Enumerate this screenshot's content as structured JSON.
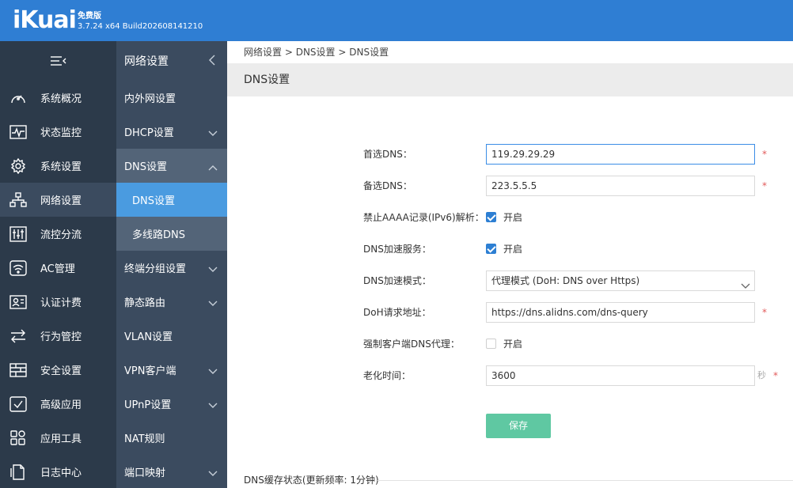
{
  "header": {
    "logo": "iKuai",
    "edition": "免费版",
    "version": "3.7.24 x64 Build202608141210"
  },
  "sidebar": {
    "items": [
      {
        "label": "系统概况",
        "icon": "dashboard-icon"
      },
      {
        "label": "状态监控",
        "icon": "monitor-icon"
      },
      {
        "label": "系统设置",
        "icon": "gear-icon"
      },
      {
        "label": "网络设置",
        "icon": "network-icon"
      },
      {
        "label": "流控分流",
        "icon": "sliders-icon"
      },
      {
        "label": "AC管理",
        "icon": "wifi-icon"
      },
      {
        "label": "认证计费",
        "icon": "id-card-icon"
      },
      {
        "label": "行为管控",
        "icon": "arrows-icon"
      },
      {
        "label": "安全设置",
        "icon": "firewall-icon"
      },
      {
        "label": "高级应用",
        "icon": "checkbox-icon"
      },
      {
        "label": "应用工具",
        "icon": "apps-icon"
      },
      {
        "label": "日志中心",
        "icon": "document-icon"
      }
    ]
  },
  "subnav": {
    "title": "网络设置",
    "items": [
      {
        "label": "内外网设置"
      },
      {
        "label": "DHCP设置"
      },
      {
        "label": "DNS设置"
      },
      {
        "label": "DNS设置"
      },
      {
        "label": "多线路DNS"
      },
      {
        "label": "终端分组设置"
      },
      {
        "label": "静态路由"
      },
      {
        "label": "VLAN设置"
      },
      {
        "label": "VPN客户端"
      },
      {
        "label": "UPnP设置"
      },
      {
        "label": "NAT规则"
      },
      {
        "label": "端口映射"
      }
    ]
  },
  "breadcrumb": {
    "a": "网络设置",
    "sep1": " > ",
    "b": "DNS设置",
    "sep2": " > ",
    "c": "DNS设置"
  },
  "page": {
    "title": "DNS设置"
  },
  "form": {
    "primary_dns_label": "首选DNS：",
    "primary_dns_value": "119.29.29.29",
    "secondary_dns_label": "备选DNS：",
    "secondary_dns_value": "223.5.5.5",
    "aaaa_label": "禁止AAAA记录(IPv6)解析：",
    "aaaa_text": "开启",
    "accel_label": "DNS加速服务：",
    "accel_text": "开启",
    "mode_label": "DNS加速模式：",
    "mode_value": "代理模式 (DoH: DNS over Https)",
    "doh_label": "DoH请求地址：",
    "doh_value": "https://dns.alidns.com/dns-query",
    "force_label": "强制客户端DNS代理：",
    "force_text": "开启",
    "aging_label": "老化时间：",
    "aging_value": "3600",
    "aging_unit": "秒",
    "required_mark": "*",
    "save_label": "保存"
  },
  "cache": {
    "label": "DNS缓存状态(更新频率: 1分钟)"
  },
  "colors": {
    "header": "#2f7ed3",
    "sidebar": "#2c3a4a",
    "subnav": "#3b4b5f",
    "subnav_active": "#4a9be0",
    "save_button": "#5fc8a2",
    "required": "#e25a5a"
  }
}
